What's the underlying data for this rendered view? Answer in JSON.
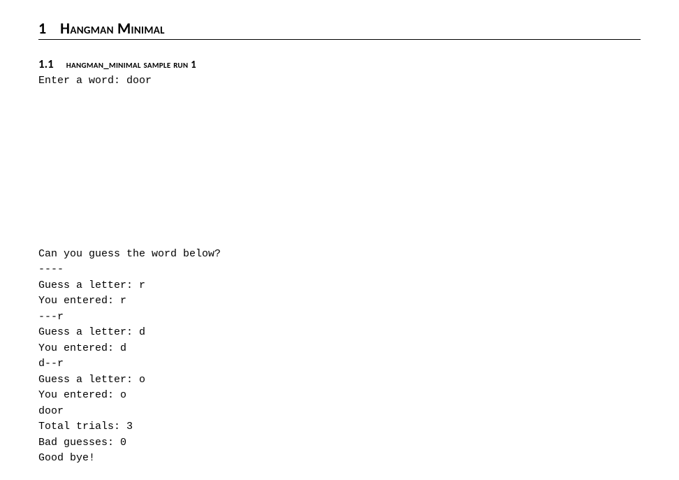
{
  "section": {
    "number": "1",
    "title": "Hangman Minimal"
  },
  "subsection": {
    "number": "1.1",
    "title": "hangman_minimal sample run 1"
  },
  "code_lines": [
    "Enter a word: door",
    "",
    "",
    "",
    "",
    "",
    "",
    "",
    "",
    "",
    "",
    "Can you guess the word below?",
    "----",
    "Guess a letter: r",
    "You entered: r",
    "---r",
    "Guess a letter: d",
    "You entered: d",
    "d--r",
    "Guess a letter: o",
    "You entered: o",
    "door",
    "Total trials: 3",
    "Bad guesses: 0",
    "Good bye!"
  ]
}
